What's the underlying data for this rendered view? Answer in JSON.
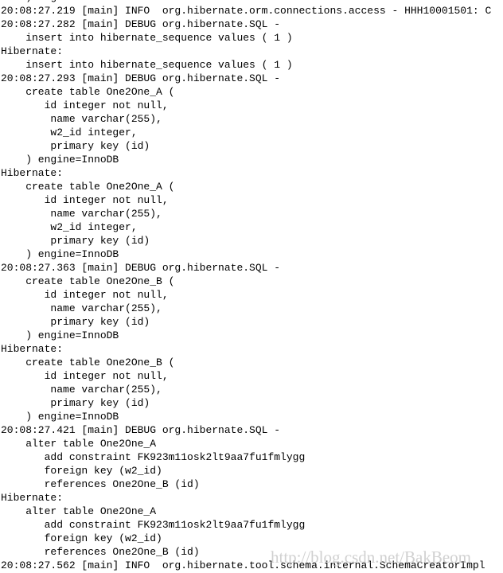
{
  "console": {
    "lines": [
      "    ) engine=InnoDB",
      "20:08:27.219 [main] INFO  org.hibernate.orm.connections.access - HHH10001501: C",
      "20:08:27.282 [main] DEBUG org.hibernate.SQL -",
      "    insert into hibernate_sequence values ( 1 )",
      "Hibernate:",
      "    insert into hibernate_sequence values ( 1 )",
      "20:08:27.293 [main] DEBUG org.hibernate.SQL -",
      "    create table One2One_A (",
      "       id integer not null,",
      "        name varchar(255),",
      "        w2_id integer,",
      "        primary key (id)",
      "    ) engine=InnoDB",
      "Hibernate:",
      "    create table One2One_A (",
      "       id integer not null,",
      "        name varchar(255),",
      "        w2_id integer,",
      "        primary key (id)",
      "    ) engine=InnoDB",
      "20:08:27.363 [main] DEBUG org.hibernate.SQL -",
      "    create table One2One_B (",
      "       id integer not null,",
      "        name varchar(255),",
      "        primary key (id)",
      "    ) engine=InnoDB",
      "Hibernate:",
      "    create table One2One_B (",
      "       id integer not null,",
      "        name varchar(255),",
      "        primary key (id)",
      "    ) engine=InnoDB",
      "20:08:27.421 [main] DEBUG org.hibernate.SQL -",
      "    alter table One2One_A",
      "       add constraint FK923m11osk2lt9aa7fu1fmlygg",
      "       foreign key (w2_id)",
      "       references One2One_B (id)",
      "Hibernate:",
      "    alter table One2One_A",
      "       add constraint FK923m11osk2lt9aa7fu1fmlygg",
      "       foreign key (w2_id)",
      "       references One2One_B (id)",
      "20:08:27.562 [main] INFO  org.hibernate.tool.schema.internal.SchemaCreatorImpl"
    ]
  },
  "watermark": "http://blog.csdn.net/BakBeom"
}
